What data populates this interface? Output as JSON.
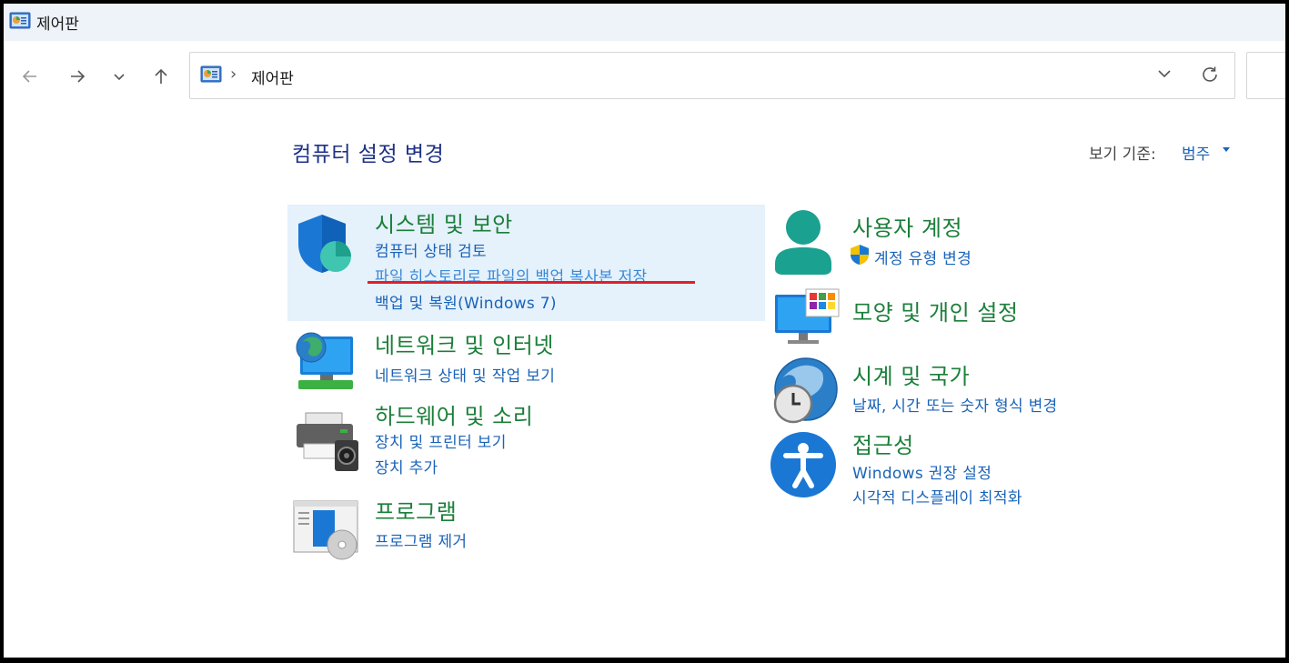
{
  "window": {
    "title": "제어판"
  },
  "address": {
    "path": "제어판"
  },
  "page": {
    "heading": "컴퓨터 설정 변경",
    "view_by_label": "보기 기준:",
    "view_by_value": "범주"
  },
  "categories_left": [
    {
      "title": "시스템 및 보안",
      "icon": "shield-icon",
      "links": [
        "컴퓨터 상태 검토",
        "파일 히스토리로 파일의 백업 복사본 저장",
        "백업 및 복원(Windows 7)"
      ]
    },
    {
      "title": "네트워크 및 인터넷",
      "icon": "network-globe-icon",
      "links": [
        "네트워크 상태 및 작업 보기"
      ]
    },
    {
      "title": "하드웨어 및 소리",
      "icon": "printer-speaker-icon",
      "links": [
        "장치 및 프린터 보기",
        "장치 추가"
      ]
    },
    {
      "title": "프로그램",
      "icon": "programs-disc-icon",
      "links": [
        "프로그램 제거"
      ]
    }
  ],
  "categories_right": [
    {
      "title": "사용자 계정",
      "icon": "user-icon",
      "links": [
        "계정 유형 변경"
      ]
    },
    {
      "title": "모양 및 개인 설정",
      "icon": "monitor-personalize-icon",
      "links": []
    },
    {
      "title": "시계 및 국가",
      "icon": "clock-globe-icon",
      "links": [
        "날짜, 시간 또는 숫자 형식 변경"
      ]
    },
    {
      "title": "접근성",
      "icon": "accessibility-icon",
      "links": [
        "Windows 권장 설정",
        "시각적 디스플레이 최적화"
      ]
    }
  ],
  "colors": {
    "category_title": "#1b7f3a",
    "link": "#1a63b8",
    "heading": "#1e3287",
    "highlight_bg": "#e5f1fb",
    "annotation_underline": "#e21d2d"
  }
}
